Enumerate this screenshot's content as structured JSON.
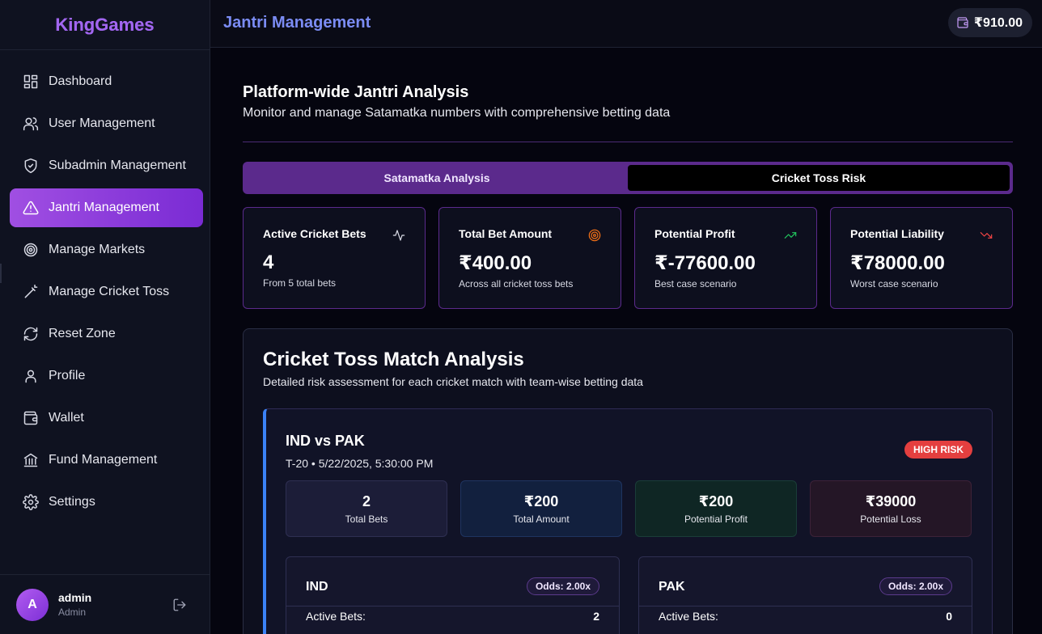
{
  "app": {
    "name": "KingGames"
  },
  "sidebar": {
    "items": [
      {
        "label": "Dashboard",
        "icon": "dashboard-icon"
      },
      {
        "label": "User Management",
        "icon": "users-icon"
      },
      {
        "label": "Subadmin Management",
        "icon": "shield-icon"
      },
      {
        "label": "Jantri Management",
        "icon": "warning-icon",
        "active": true
      },
      {
        "label": "Manage Markets",
        "icon": "target-icon"
      },
      {
        "label": "Manage Cricket Toss",
        "icon": "wand-icon"
      },
      {
        "label": "Reset Zone",
        "icon": "refresh-icon"
      },
      {
        "label": "Profile",
        "icon": "user-icon"
      },
      {
        "label": "Wallet",
        "icon": "wallet-icon"
      },
      {
        "label": "Fund Management",
        "icon": "bank-icon"
      },
      {
        "label": "Settings",
        "icon": "gear-icon"
      }
    ],
    "user": {
      "initial": "A",
      "name": "admin",
      "role": "Admin"
    }
  },
  "header": {
    "title": "Jantri Management",
    "balance": "₹910.00"
  },
  "main": {
    "title": "Platform-wide Jantri Analysis",
    "subtitle": "Monitor and manage Satamatka numbers with comprehensive betting data",
    "tabs": [
      {
        "label": "Satamatka Analysis",
        "active": false
      },
      {
        "label": "Cricket Toss Risk",
        "active": true
      }
    ],
    "stats": [
      {
        "label": "Active Cricket Bets",
        "value": "4",
        "note": "From 5 total bets",
        "icon": "activity-icon",
        "color": "#d7d9e4"
      },
      {
        "label": "Total Bet Amount",
        "value": "₹400.00",
        "note": "Across all cricket toss bets",
        "icon": "target-icon",
        "color": "#f97316"
      },
      {
        "label": "Potential Profit",
        "value": "₹-77600.00",
        "note": "Best case scenario",
        "icon": "trending-up-icon",
        "color": "#22c55e"
      },
      {
        "label": "Potential Liability",
        "value": "₹78000.00",
        "note": "Worst case scenario",
        "icon": "trending-down-icon",
        "color": "#ef4444"
      }
    ],
    "analysis": {
      "title": "Cricket Toss Match Analysis",
      "subtitle": "Detailed risk assessment for each cricket match with team-wise betting data",
      "match": {
        "title": "IND vs PAK",
        "meta": "T-20 • 5/22/2025, 5:30:00 PM",
        "risk": "HIGH RISK",
        "stats": [
          {
            "value": "2",
            "label": "Total Bets"
          },
          {
            "value": "₹200",
            "label": "Total Amount"
          },
          {
            "value": "₹200",
            "label": "Potential Profit"
          },
          {
            "value": "₹39000",
            "label": "Potential Loss"
          }
        ],
        "teams": [
          {
            "name": "IND",
            "odds": "Odds: 2.00x",
            "row_label": "Active Bets:",
            "row_value": "2"
          },
          {
            "name": "PAK",
            "odds": "Odds: 2.00x",
            "row_label": "Active Bets:",
            "row_value": "0"
          }
        ]
      }
    }
  }
}
